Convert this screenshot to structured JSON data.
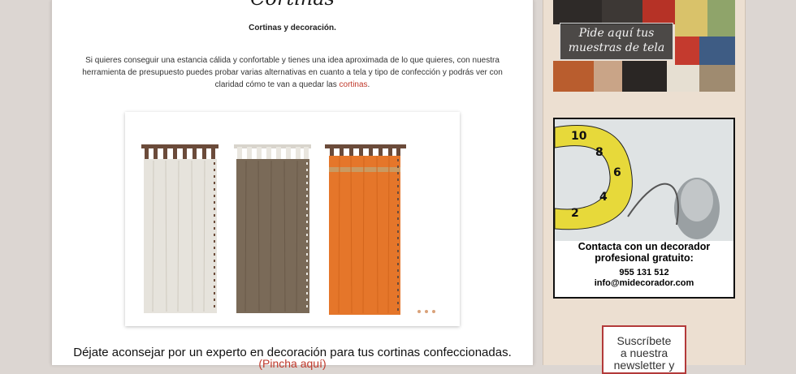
{
  "page": {
    "heading": "Cortinas",
    "subtitle": "Cortinas y decoración.",
    "intro_text": "Si quieres conseguir una estancia cálida y confortable y tienes una idea aproximada de lo que quieres, con nuestra herramienta de presupuesto puedes probar varias alternativas en cuanto a tela y tipo de confección y podrás ver con claridad cómo te van a quedar las",
    "intro_link": "cortinas",
    "intro_end": ".",
    "cta_text": "Déjate aconsejar por un experto en decoración para tus cortinas confeccionadas.",
    "cta_link": "(Pincha aquí)"
  },
  "slider": {
    "curtain_colors": [
      "#e6e3dc",
      "#7a6a58",
      "#e5762a"
    ],
    "tab_color": "#6b4b3a"
  },
  "sidebar": {
    "samples_banner_text": "Pide aquí tus muestras de tela",
    "decorator_banner": {
      "title_line1": "Contacta con un decorador",
      "title_line2": "profesional gratuito:",
      "phone": "955 131 512",
      "email": "info@midecorador.com"
    },
    "subscribe_text_1": "Suscríbete",
    "subscribe_text_2": "a nuestra",
    "subscribe_text_3": "newsletter y"
  },
  "colors": {
    "link": "#c0392b",
    "sidebar_bg": "#ecdfd1"
  }
}
